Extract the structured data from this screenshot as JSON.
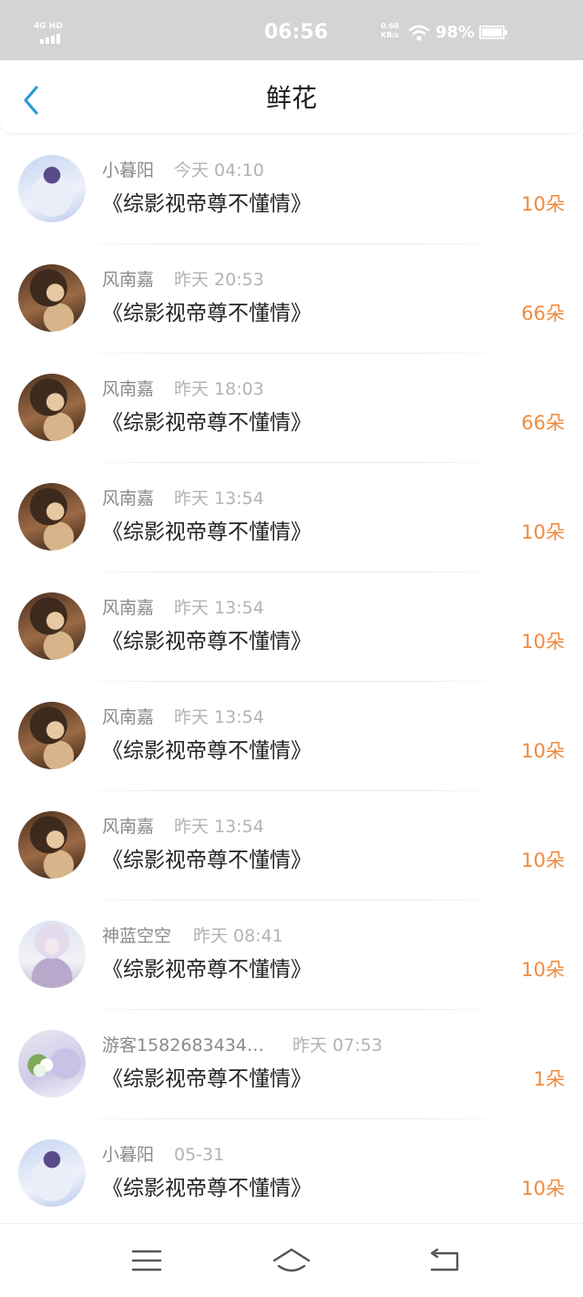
{
  "status_bar": {
    "network": "4G HD",
    "time": "06:56",
    "speed_value": "0.60",
    "speed_unit": "KB/s",
    "battery": "98%",
    "icons": [
      "signal-icon",
      "wifi-icon",
      "battery-icon"
    ]
  },
  "header": {
    "title": "鲜花",
    "back_icon": "chevron-left-icon"
  },
  "colors": {
    "accent_blue": "#2d9ad9",
    "count_orange": "#f08a3e",
    "name_gray": "#8a8a8a",
    "time_gray": "#b3b3b3",
    "status_bar_bg": "#d4d4d4"
  },
  "items": [
    {
      "name": "小暮阳",
      "time": "今天 04:10",
      "book": "《综影视帝尊不懂情》",
      "count": "10朵",
      "avatar": "avatar-blue-character"
    },
    {
      "name": "风南嘉",
      "time": "昨天 20:53",
      "book": "《综影视帝尊不懂情》",
      "count": "66朵",
      "avatar": "avatar-brown-hair-girl"
    },
    {
      "name": "风南嘉",
      "time": "昨天 18:03",
      "book": "《综影视帝尊不懂情》",
      "count": "66朵",
      "avatar": "avatar-brown-hair-girl"
    },
    {
      "name": "风南嘉",
      "time": "昨天 13:54",
      "book": "《综影视帝尊不懂情》",
      "count": "10朵",
      "avatar": "avatar-brown-hair-girl"
    },
    {
      "name": "风南嘉",
      "time": "昨天 13:54",
      "book": "《综影视帝尊不懂情》",
      "count": "10朵",
      "avatar": "avatar-brown-hair-girl"
    },
    {
      "name": "风南嘉",
      "time": "昨天 13:54",
      "book": "《综影视帝尊不懂情》",
      "count": "10朵",
      "avatar": "avatar-brown-hair-girl"
    },
    {
      "name": "风南嘉",
      "time": "昨天 13:54",
      "book": "《综影视帝尊不懂情》",
      "count": "10朵",
      "avatar": "avatar-brown-hair-girl"
    },
    {
      "name": "神蓝空空",
      "time": "昨天 08:41",
      "book": "《综影视帝尊不懂情》",
      "count": "10朵",
      "avatar": "avatar-white-hair-character"
    },
    {
      "name": "游客1582683434…",
      "time": "昨天 07:53",
      "book": "《综影视帝尊不懂情》",
      "count": "1朵",
      "avatar": "avatar-flowers"
    },
    {
      "name": "小暮阳",
      "time": "05-31",
      "book": "《综影视帝尊不懂情》",
      "count": "10朵",
      "avatar": "avatar-blue-character"
    }
  ],
  "bottom_nav": {
    "icons": [
      "menu-icon",
      "home-icon",
      "back-icon"
    ]
  }
}
